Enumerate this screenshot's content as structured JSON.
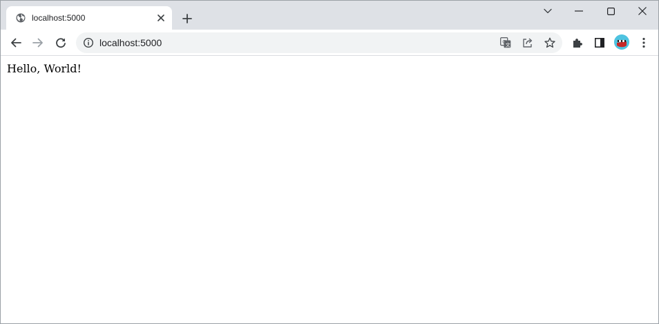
{
  "tab": {
    "title": "localhost:5000",
    "favicon": "globe-icon"
  },
  "window_controls": {
    "icons": [
      "tab-search-icon",
      "minimize-icon",
      "maximize-icon",
      "close-icon"
    ]
  },
  "toolbar": {
    "back_icon": "arrow-left-icon",
    "forward_icon": "arrow-right-icon",
    "reload_icon": "reload-icon",
    "site_info_icon": "info-icon",
    "url": "localhost:5000",
    "omnibox_icons": [
      "translate-icon",
      "share-icon",
      "star-icon"
    ],
    "extensions_icon": "puzzle-icon",
    "side_panel_icon": "side-panel-icon",
    "menu_icon": "kebab-menu-icon"
  },
  "page": {
    "body_text": "Hello, World!"
  },
  "colors": {
    "tabstrip_bg": "#dee1e6",
    "omnibox_bg": "#f1f3f4",
    "icon_color": "#5f6368",
    "avatar_bg": "#4ec3e0"
  }
}
